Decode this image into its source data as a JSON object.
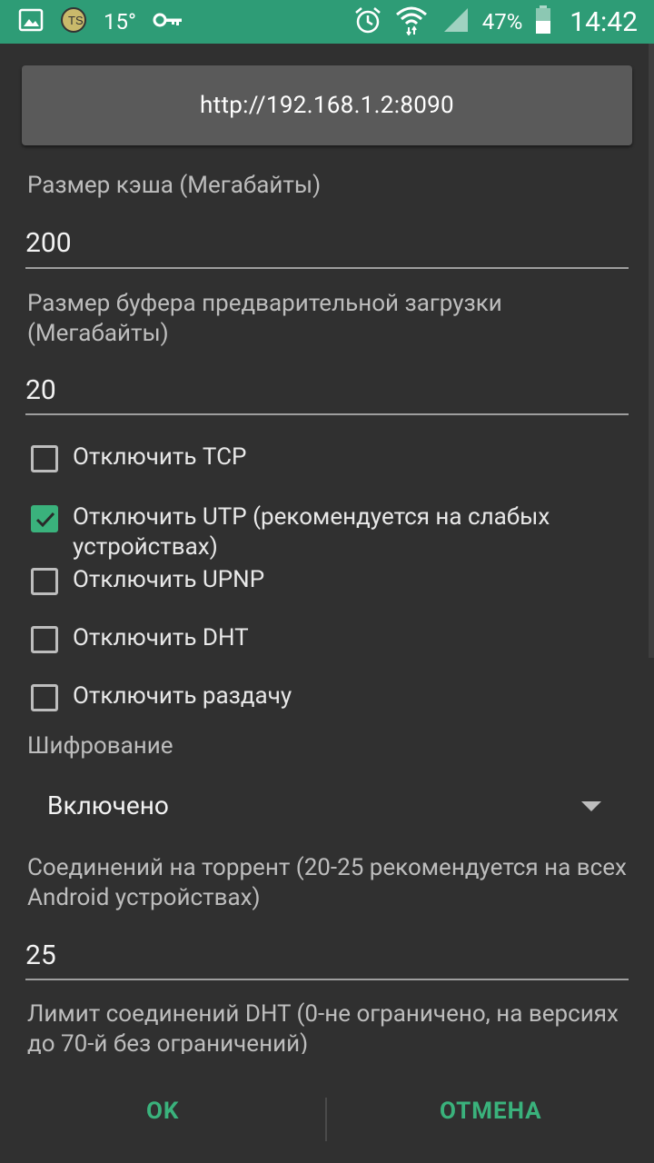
{
  "status_bar": {
    "temperature": "15°",
    "battery": "47%",
    "time": "14:42"
  },
  "url_button": {
    "label": "http://192.168.1.2:8090"
  },
  "cache_size": {
    "label": "Размер кэша (Мегабайты)",
    "value": "200"
  },
  "preload_buffer": {
    "label": "Размер буфера предварительной загрузки (Мегабайты)",
    "value": "20"
  },
  "checkboxes": [
    {
      "label": "Отключить TCP",
      "checked": false
    },
    {
      "label": "Отключить UTP (рекомендуется на слабых устройствах)",
      "checked": true
    },
    {
      "label": "Отключить UPNP",
      "checked": false
    },
    {
      "label": "Отключить DHT",
      "checked": false
    },
    {
      "label": "Отключить раздачу",
      "checked": false
    }
  ],
  "encryption": {
    "label": "Шифрование",
    "value": "Включено"
  },
  "connections": {
    "label": "Соединений на торрент (20-25 рекомендуется на всех Android устройствах)",
    "value": "25"
  },
  "dht_limit": {
    "label": "Лимит соединений DHT (0-не ограничено, на версиях до 70-й без ограничений)"
  },
  "buttons": {
    "ok": "OK",
    "cancel": "ОТМЕНА"
  },
  "colors": {
    "accent": "#3ab27c",
    "status_bar": "#2e9c76",
    "background": "#303030"
  }
}
